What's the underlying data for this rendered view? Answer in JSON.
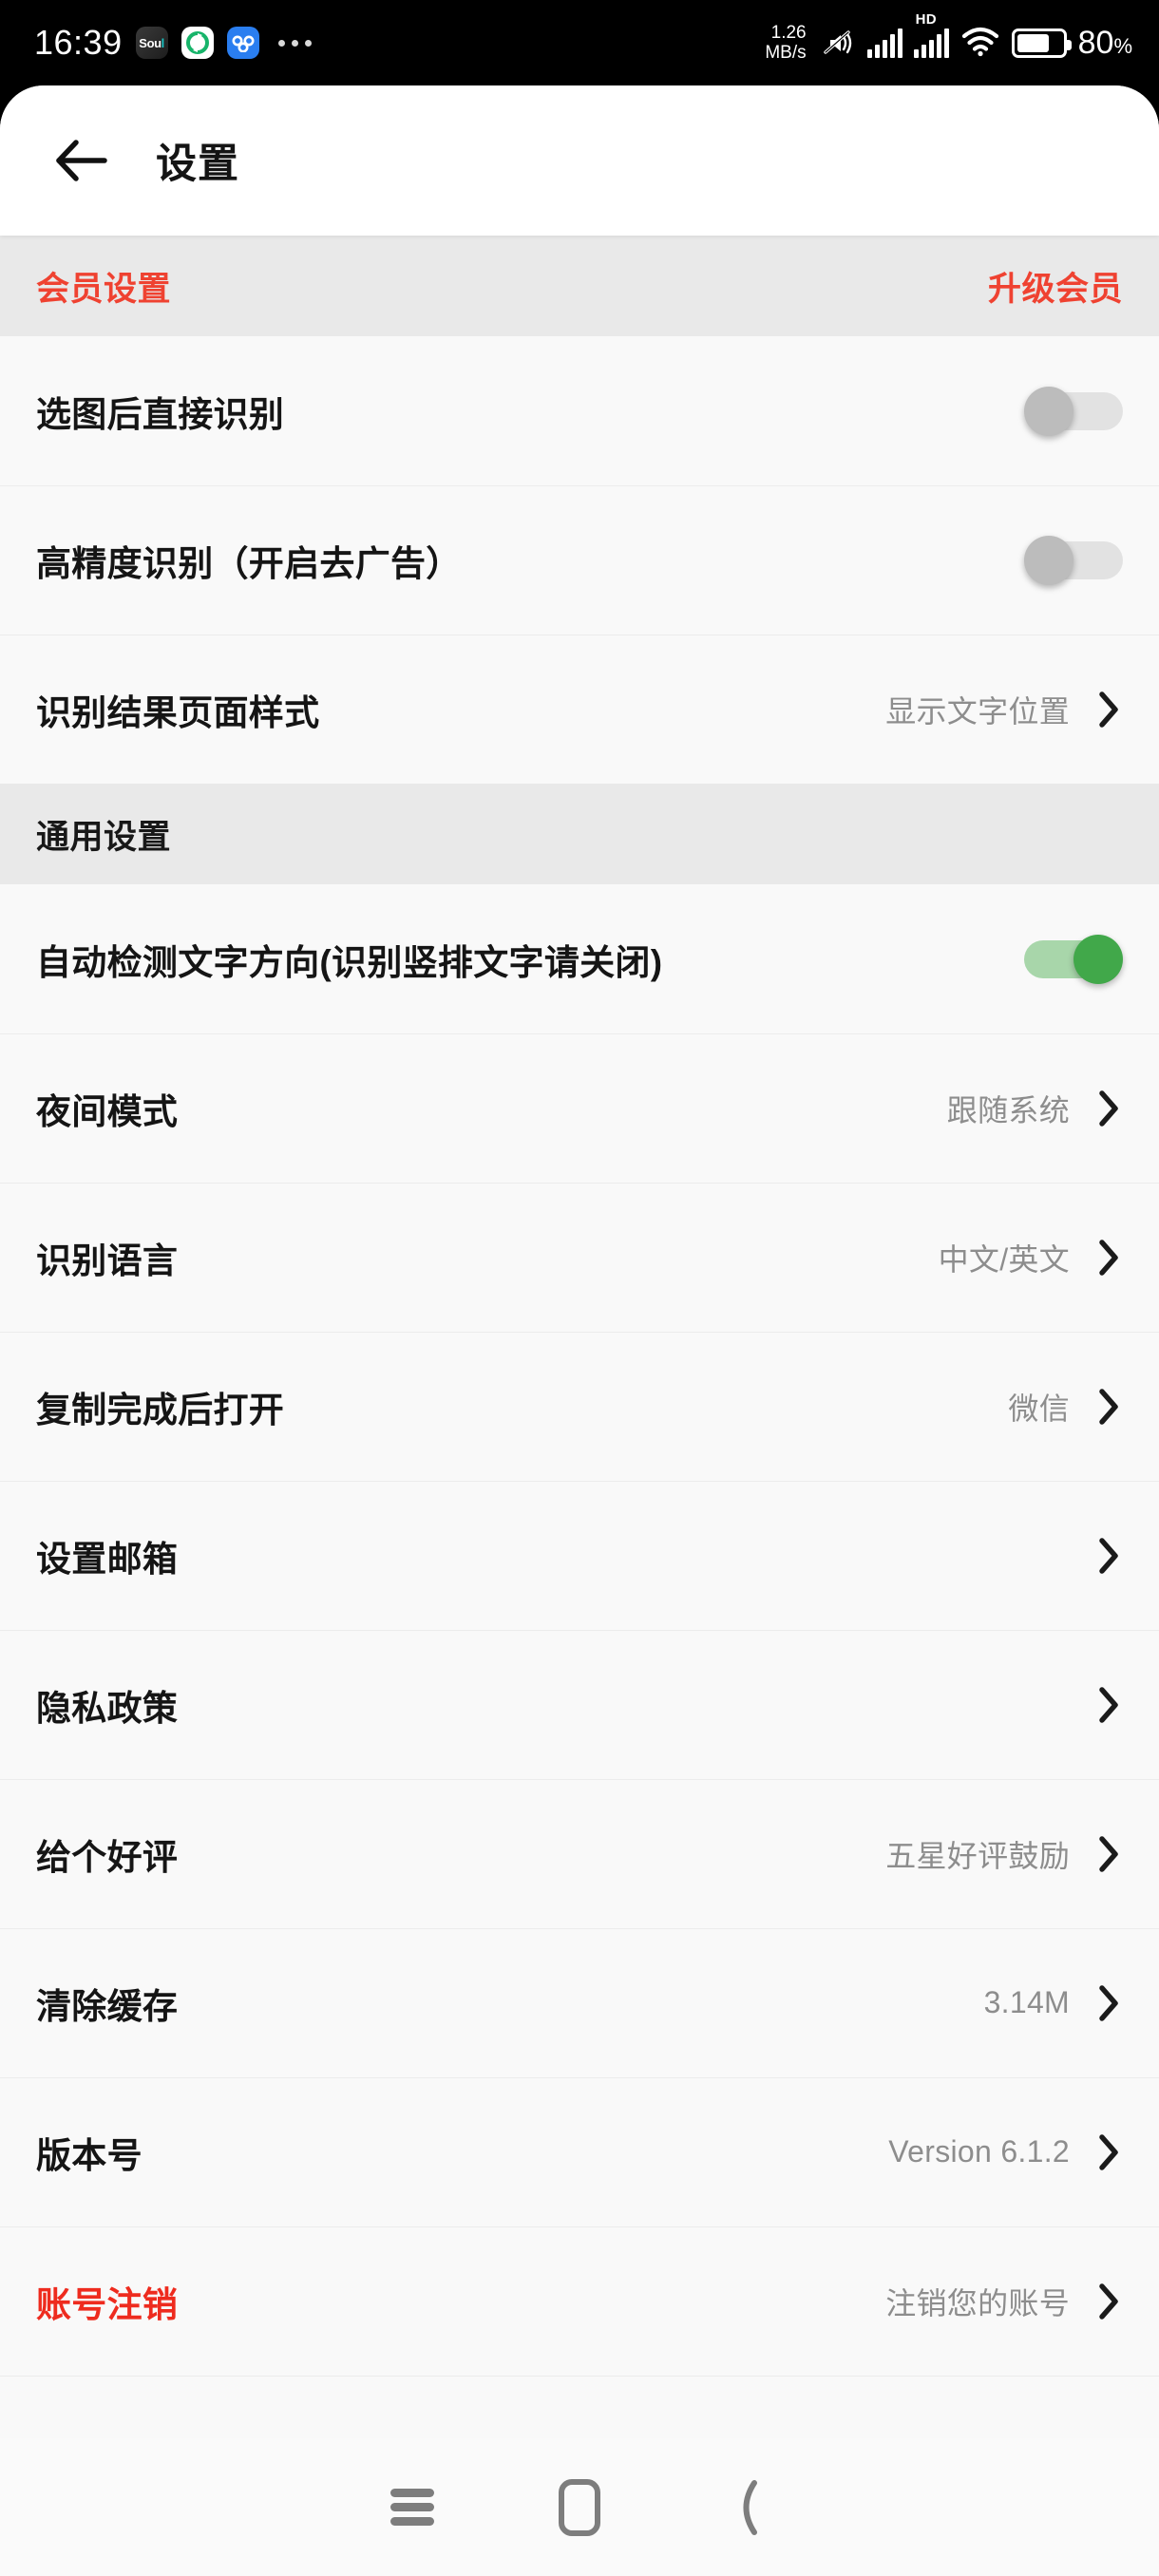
{
  "status_bar": {
    "time": "16:39",
    "app_icons": [
      {
        "name": "soul-app-icon",
        "label": "Soul"
      },
      {
        "name": "wechat-moments-app-icon",
        "label": ""
      },
      {
        "name": "baidu-netdisk-app-icon",
        "label": ""
      }
    ],
    "overflow_icon": "more-dots-icon",
    "net_speed_value": "1.26",
    "net_speed_unit": "MB/s",
    "mute_icon": "silent-mode-icon",
    "signal_icon": "cellular-signal-icon",
    "signal_icon_2": "cellular-signal-2-icon",
    "hd_label": "HD",
    "wifi_icon": "wifi-icon",
    "battery_icon": "battery-icon",
    "battery_percent": "80",
    "battery_percent_symbol": "%"
  },
  "topbar": {
    "back_icon": "back-arrow-icon",
    "title": "设置"
  },
  "sections": [
    {
      "name": "member-settings",
      "title": "会员设置",
      "title_color": "#ef4231",
      "action_label": "升级会员",
      "action_color": "#ef4231",
      "rows": [
        {
          "name": "row-direct-recognize-after-pick",
          "label": "选图后直接识别",
          "control": "toggle",
          "toggle_on": false
        },
        {
          "name": "row-high-accuracy-recognize",
          "label": "高精度识别（开启去广告）",
          "control": "toggle",
          "toggle_on": false
        },
        {
          "name": "row-result-page-style",
          "label": "识别结果页面样式",
          "control": "chevron",
          "value": "显示文字位置"
        }
      ]
    },
    {
      "name": "general-settings",
      "title": "通用设置",
      "title_color": "#181818",
      "action_label": "",
      "rows": [
        {
          "name": "row-auto-detect-text-direction",
          "label": "自动检测文字方向(识别竖排文字请关闭)",
          "control": "toggle",
          "toggle_on": true
        },
        {
          "name": "row-night-mode",
          "label": "夜间模式",
          "control": "chevron",
          "value": "跟随系统"
        },
        {
          "name": "row-recognition-language",
          "label": "识别语言",
          "control": "chevron",
          "value": "中文/英文"
        },
        {
          "name": "row-open-after-copy",
          "label": "复制完成后打开",
          "control": "chevron",
          "value": "微信"
        },
        {
          "name": "row-set-email",
          "label": "设置邮箱",
          "control": "chevron",
          "value": ""
        },
        {
          "name": "row-privacy-policy",
          "label": "隐私政策",
          "control": "chevron",
          "value": ""
        },
        {
          "name": "row-rate-app",
          "label": "给个好评",
          "control": "chevron",
          "value": "五星好评鼓励"
        },
        {
          "name": "row-clear-cache",
          "label": "清除缓存",
          "control": "chevron",
          "value": "3.14M"
        },
        {
          "name": "row-version",
          "label": "版本号",
          "control": "chevron",
          "value": "Version 6.1.2"
        },
        {
          "name": "row-account-deletion",
          "label": "账号注销",
          "label_color": "#ee2b1e",
          "control": "chevron",
          "value": "注销您的账号"
        }
      ]
    }
  ],
  "navbar": {
    "menu_icon": "recents-menu-icon",
    "home_icon": "home-square-icon",
    "back_icon": "system-back-icon"
  },
  "colors": {
    "accent_red": "#ef4231",
    "toggle_on_knob": "#41a84a",
    "toggle_on_track": "#a8d6aa",
    "toggle_off_knob": "#bcbcbc",
    "toggle_off_track": "#e2e2e2",
    "section_bg": "#e9e9e9",
    "row_bg": "#f9f9f9"
  }
}
